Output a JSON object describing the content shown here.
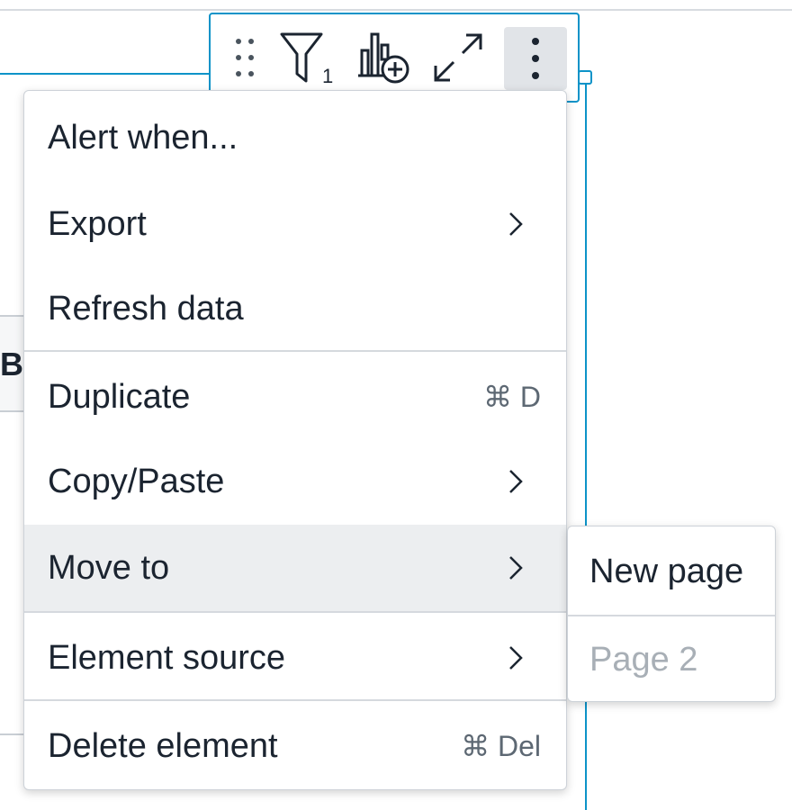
{
  "toolbar": {
    "filter_count": "1",
    "icons": [
      "drag-handle-icon",
      "filter-icon",
      "add-chart-icon",
      "expand-icon",
      "more-vertical-icon"
    ]
  },
  "background": {
    "tab_letter": "B"
  },
  "menu": {
    "items": [
      {
        "label": "Alert when...",
        "shortcut": "",
        "has_submenu": false
      },
      {
        "label": "Export",
        "shortcut": "",
        "has_submenu": true
      },
      {
        "label": "Refresh data",
        "shortcut": "",
        "has_submenu": false
      },
      {
        "label": "Duplicate",
        "shortcut": "⌘ D",
        "has_submenu": false
      },
      {
        "label": "Copy/Paste",
        "shortcut": "",
        "has_submenu": true
      },
      {
        "label": "Move to",
        "shortcut": "",
        "has_submenu": true,
        "active": true
      },
      {
        "label": "Element source",
        "shortcut": "",
        "has_submenu": true
      },
      {
        "label": "Delete element",
        "shortcut": "⌘ Del",
        "has_submenu": false
      }
    ]
  },
  "submenu": {
    "items": [
      {
        "label": "New page",
        "enabled": true
      },
      {
        "label": "Page 2",
        "enabled": false
      }
    ]
  },
  "colors": {
    "accent": "#0d93c8",
    "text": "#1b2430",
    "muted": "#5d6873",
    "disabled": "#a8afb6",
    "hover": "#eceef0"
  }
}
